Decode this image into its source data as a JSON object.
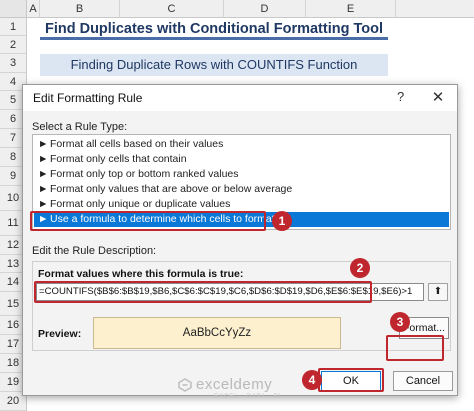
{
  "sheet": {
    "columns": [
      "A",
      "B",
      "C",
      "D",
      "E"
    ],
    "rows": [
      "1",
      "2",
      "3",
      "4",
      "5",
      "6",
      "7",
      "8",
      "9",
      "10",
      "11",
      "12",
      "13",
      "14",
      "15",
      "16",
      "17",
      "18",
      "19",
      "20"
    ],
    "title": "Find Duplicates with Conditional Formatting Tool",
    "subtitle": "Finding Duplicate Rows with COUNTIFS Function"
  },
  "dialog": {
    "title": "Edit Formatting Rule",
    "help": "?",
    "close": "✕",
    "select_rule_label": "Select a Rule Type:",
    "rule_types": [
      "Format all cells based on their values",
      "Format only cells that contain",
      "Format only top or bottom ranked values",
      "Format only values that are above or below average",
      "Format only unique or duplicate values",
      "Use a formula to determine which cells to format"
    ],
    "selected_rule_index": 5,
    "edit_desc_label": "Edit the Rule Description:",
    "format_values_label": "Format values where this formula is true:",
    "formula": "=COUNTIFS($B$6:$B$19,$B6,$C$6:$C$19,$C6,$D$6:$D$19,$D6,$E$6:$E$19,$E6)>1",
    "collapse_glyph": "⬆",
    "preview_label": "Preview:",
    "preview_text": "AaBbCcYyZz",
    "format_button": "Format...",
    "ok_button": "OK",
    "cancel_button": "Cancel"
  },
  "annotations": [
    "1",
    "2",
    "3",
    "4"
  ],
  "watermark": {
    "name": "exceldemy",
    "tagline": "EXCEL · DATA · BI"
  },
  "colors": {
    "accent": "#0a78d7",
    "annotation": "#c0262d",
    "title_text": "#1f3864",
    "subtitle_bg": "#dce6f2",
    "preview_bg": "#fdf0cf"
  }
}
